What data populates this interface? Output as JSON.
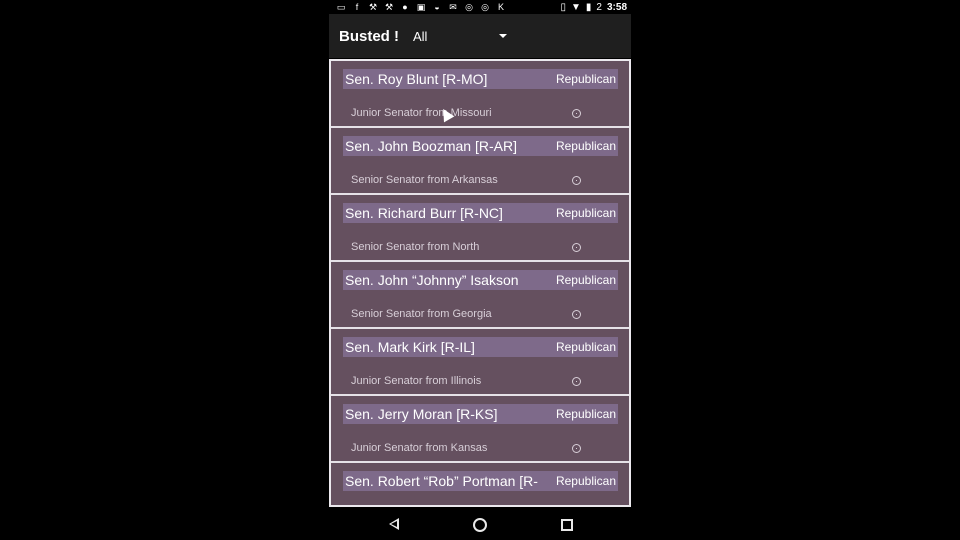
{
  "status_bar": {
    "icons": [
      "chat-icon",
      "fb-icon",
      "wrench-icon",
      "wrench-icon",
      "b-icon",
      "image-icon",
      "app-icon",
      "gmail-icon",
      "instagram-icon",
      "instagram-icon",
      "k-icon",
      "vibrate-icon",
      "wifi-icon",
      "battery-icon"
    ],
    "battery": "2",
    "time": "3:58"
  },
  "app_bar": {
    "title": "Busted !",
    "filter_value": "All"
  },
  "senators": [
    {
      "name": "Sen. Roy Blunt [R-MO]",
      "party": "Republican",
      "description": "Junior Senator from Missouri"
    },
    {
      "name": "Sen. John Boozman [R-AR]",
      "party": "Republican",
      "description": "Senior Senator from Arkansas"
    },
    {
      "name": "Sen. Richard Burr [R-NC]",
      "party": "Republican",
      "description": "Senior Senator from North"
    },
    {
      "name": "Sen. John “Johnny” Isakson",
      "party": "Republican",
      "description": "Senior Senator from Georgia"
    },
    {
      "name": "Sen. Mark Kirk [R-IL]",
      "party": "Republican",
      "description": "Junior Senator from Illinois"
    },
    {
      "name": "Sen. Jerry Moran [R-KS]",
      "party": "Republican",
      "description": "Junior Senator from Kansas"
    },
    {
      "name": "Sen. Robert “Rob” Portman [R-",
      "party": "Republican",
      "description": ""
    }
  ],
  "nav": [
    "back-icon",
    "home-icon",
    "recents-icon"
  ]
}
